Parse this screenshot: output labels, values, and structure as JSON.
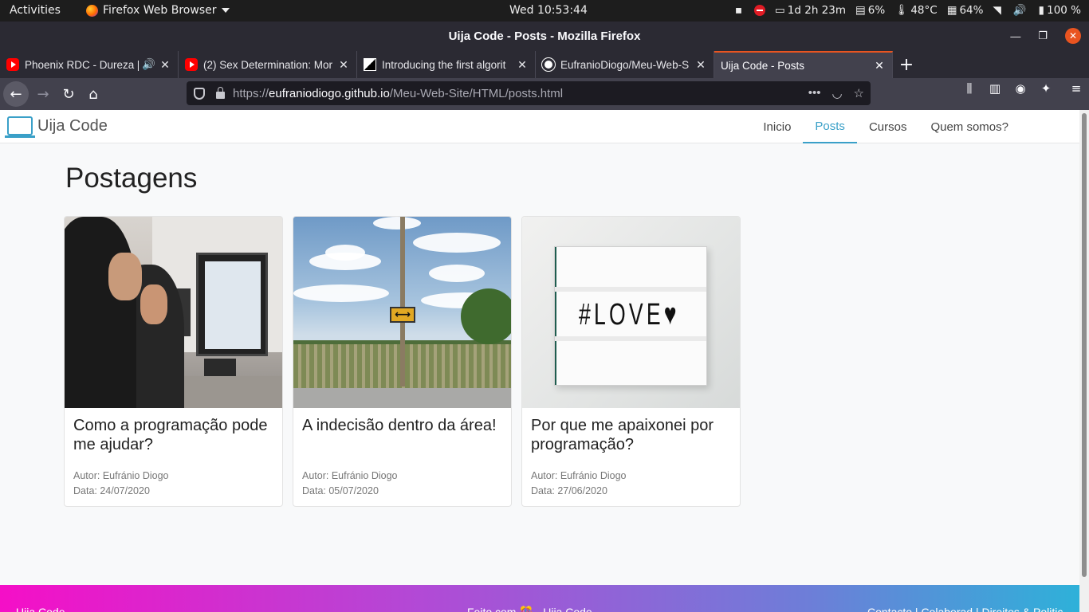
{
  "system_bar": {
    "activities": "Activities",
    "app_name": "Firefox Web Browser",
    "clock": "Wed 10:53:44",
    "uptime": "1d 2h 23m",
    "disk": "6%",
    "temperature": "48°C",
    "memory": "64%",
    "volume_battery": "100 %"
  },
  "window": {
    "title": "Uija Code - Posts - Mozilla Firefox"
  },
  "tabs": [
    {
      "label": "Phoenix RDC - Dureza [V",
      "icon": "youtube-icon"
    },
    {
      "label": "(2) Sex Determination: Mor",
      "icon": "youtube-icon"
    },
    {
      "label": "Introducing the first algorit",
      "icon": "site-icon"
    },
    {
      "label": "EufranioDiogo/Meu-Web-S",
      "icon": "github-icon"
    },
    {
      "label": "Uija Code - Posts",
      "icon": "none"
    }
  ],
  "url": {
    "scheme": "https://",
    "host": "eufraniodiogo.github.io",
    "path": "/Meu-Web-Site/HTML/posts.html"
  },
  "site": {
    "brand": "Uija Code",
    "nav": [
      "Inicio",
      "Posts",
      "Cursos",
      "Quem somos?"
    ],
    "active_nav": "Posts",
    "heading": "Postagens",
    "posts": [
      {
        "title": "Como a programação pode me ajudar?",
        "author": "Autor: Eufránio Diogo",
        "date": "Data: 24/07/2020"
      },
      {
        "title": "A indecisão dentro da área!",
        "author": "Autor: Eufránio Diogo",
        "date": "Data: 05/07/2020"
      },
      {
        "title": "Por que me apaixonei por programação?",
        "author": "Autor: Eufránio Diogo",
        "date": "Data: 27/06/2020"
      }
    ],
    "image_texts": {
      "sign": "⟷",
      "lightbox": "#LOVE♥"
    },
    "footer": {
      "brand": "Uija Code",
      "center": "Feito com 🎊 - Uija Code",
      "right": "Contacto | Colaborad | Direitos & Politic"
    }
  },
  "colors": {
    "accent": "#3aa0c8",
    "footer_start": "#f50fc7",
    "footer_end": "#2eb1d9"
  }
}
